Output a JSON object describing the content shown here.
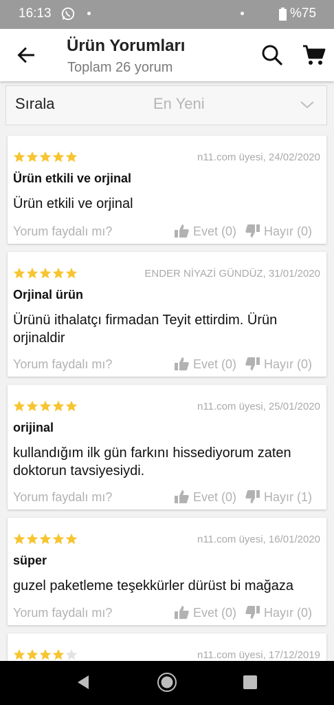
{
  "status_bar": {
    "time": "16:13",
    "battery": "%75"
  },
  "header": {
    "title": "Ürün Yorumları",
    "subtitle": "Toplam 26 yorum"
  },
  "sort": {
    "label": "Sırala",
    "value": "En Yeni"
  },
  "helpful_prompt": "Yorum faydalı mı?",
  "colors": {
    "star": "#f7c531",
    "star_empty": "#e3e3e3",
    "muted": "#b2b2b2"
  },
  "reviews": [
    {
      "rating": 5,
      "author_date": "n11.com üyesi, 24/02/2020",
      "title": "Ürün etkili ve orjinal",
      "body": "Ürün etkili ve orjinal",
      "yes": "Evet (0)",
      "no": "Hayır (0)"
    },
    {
      "rating": 5,
      "author_date": "ENDER NİYAZİ GÜNDÜZ, 31/01/2020",
      "title": "Orjinal ürün",
      "body": "Ürünü ithalatçı firmadan Teyit ettirdim. Ürün orjinaldir",
      "yes": "Evet (0)",
      "no": "Hayır (0)"
    },
    {
      "rating": 5,
      "author_date": "n11.com üyesi, 25/01/2020",
      "title": "orijinal",
      "body": "kullandığım ilk gün farkını hissediyorum zaten doktorun tavsiyesiydi.",
      "yes": "Evet (0)",
      "no": "Hayır (1)"
    },
    {
      "rating": 5,
      "author_date": "n11.com üyesi, 16/01/2020",
      "title": "süper",
      "body": "guzel paketleme teşekkürler dürüst bi mağaza",
      "yes": "Evet (0)",
      "no": "Hayır (0)"
    },
    {
      "rating": 4,
      "author_date": "n11.com üyesi, 17/12/2019",
      "title": "",
      "body": "",
      "yes": "",
      "no": ""
    }
  ]
}
